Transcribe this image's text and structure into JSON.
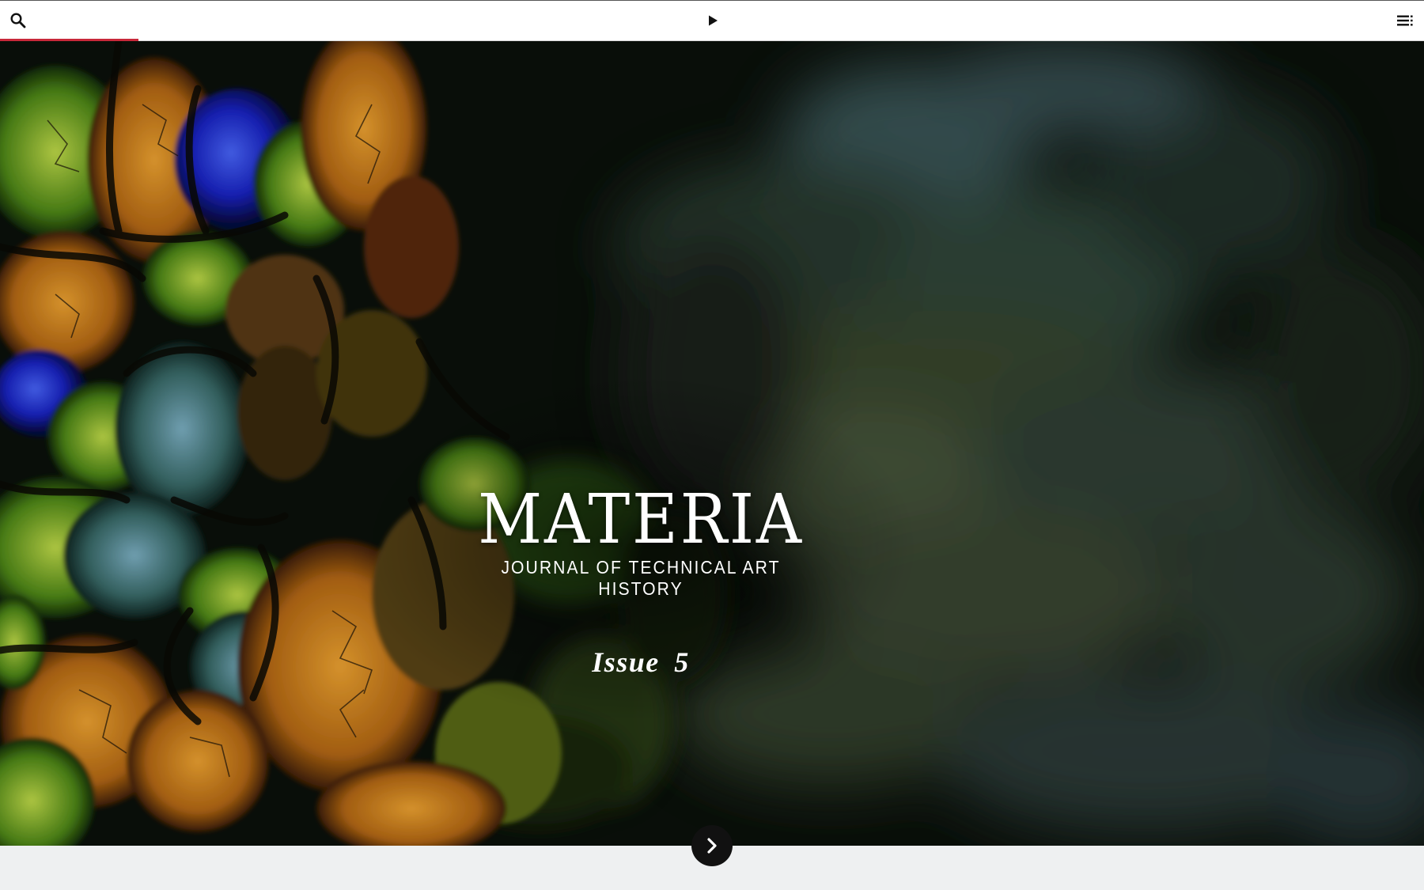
{
  "toolbar": {
    "search_icon": "search-icon",
    "play_icon": "play-icon",
    "menu_icon": "menu-list-icon",
    "progress_fraction": 0.097,
    "accent_color": "#c8283a"
  },
  "hero": {
    "title": "MATERIA",
    "subtitle": "JOURNAL OF TECHNICAL ART HISTORY",
    "issue": "Issue 5"
  },
  "navigation": {
    "next_icon": "chevron-right-icon"
  },
  "colors": {
    "toolbar_bg": "#ffffff",
    "footer_bg": "#eef0f1",
    "next_button_bg": "#111111",
    "title_text": "#ffffff"
  }
}
